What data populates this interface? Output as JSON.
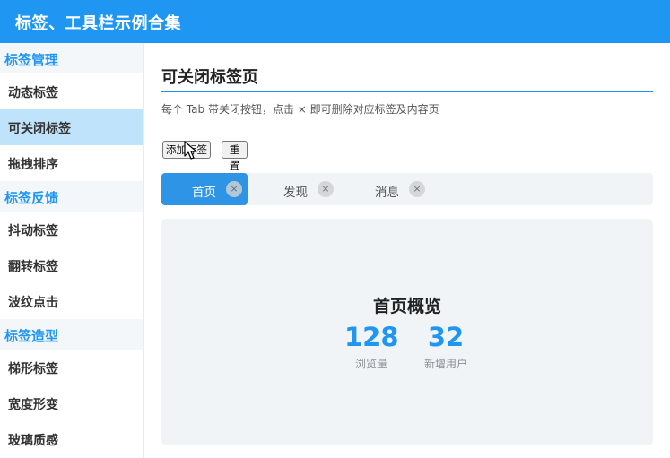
{
  "header": {
    "title": "标签、工具栏示例合集"
  },
  "sidebar": {
    "groups": [
      {
        "title": "标签管理",
        "items": [
          {
            "label": "动态标签"
          },
          {
            "label": "可关闭标签"
          },
          {
            "label": "拖拽排序"
          }
        ]
      },
      {
        "title": "标签反馈",
        "items": [
          {
            "label": "抖动标签"
          },
          {
            "label": "翻转标签"
          },
          {
            "label": "波纹点击"
          }
        ]
      },
      {
        "title": "标签造型",
        "items": [
          {
            "label": "梯形标签"
          },
          {
            "label": "宽度形变"
          },
          {
            "label": "玻璃质感"
          }
        ]
      }
    ],
    "active_item": "可关闭标签"
  },
  "main": {
    "title": "可关闭标签页",
    "description": "每个 Tab 带关闭按钮，点击 × 即可删除对应标签及内容页",
    "buttons": {
      "add": "添加标签",
      "reset": "重置"
    },
    "tabs": [
      {
        "label": "首页",
        "close": "×"
      },
      {
        "label": "发现",
        "close": "×"
      },
      {
        "label": "消息",
        "close": "×"
      }
    ],
    "active_tab": "首页",
    "panel": {
      "title": "首页概览",
      "stats": [
        {
          "value": "128",
          "label": "浏览量"
        },
        {
          "value": "32",
          "label": "新增用户"
        }
      ]
    }
  },
  "colors": {
    "accent": "#1f96f2",
    "active_tab": "#2e94e5",
    "active_sidebar": "#bfe3fb"
  }
}
